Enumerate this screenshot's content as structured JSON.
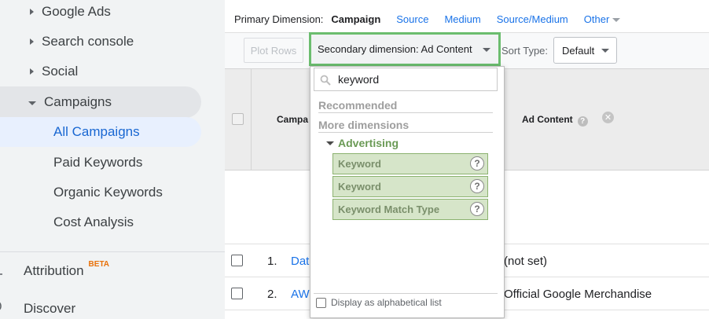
{
  "sidebar": {
    "items": [
      {
        "label": "Google Ads",
        "expanded": false
      },
      {
        "label": "Search console",
        "expanded": false
      },
      {
        "label": "Social",
        "expanded": false
      },
      {
        "label": "Campaigns",
        "expanded": true
      }
    ],
    "campaign_children": [
      {
        "label": "All Campaigns",
        "active": true
      },
      {
        "label": "Paid Keywords",
        "active": false
      },
      {
        "label": "Organic Keywords",
        "active": false
      },
      {
        "label": "Cost Analysis",
        "active": false
      }
    ],
    "attribution": {
      "label": "Attribution",
      "badge": "BETA"
    },
    "discover": {
      "label": "Discover"
    }
  },
  "primary_dimension": {
    "label": "Primary Dimension:",
    "current": "Campaign",
    "options": [
      "Source",
      "Medium",
      "Source/Medium"
    ],
    "other": "Other"
  },
  "toolbar": {
    "plot_rows": "Plot Rows",
    "secondary_dimension": "Secondary dimension: Ad Content",
    "sort_label": "Sort Type:",
    "sort_value": "Default"
  },
  "table": {
    "headers": {
      "campaign": "Campa",
      "ad_content": "Ad Content",
      "help": "?",
      "remove": "✕"
    },
    "rows": [
      {
        "num": "1.",
        "campaign": "Dat",
        "ad_content": "(not set)"
      },
      {
        "num": "2.",
        "campaign": "AW",
        "ad_content": "Official Google Merchandise"
      }
    ]
  },
  "dropdown": {
    "search_value": "keyword",
    "recommended": "Recommended",
    "more_dimensions": "More dimensions",
    "group": "Advertising",
    "options": [
      {
        "label": "Keyword",
        "help": "?"
      },
      {
        "label": "Keyword",
        "help": "?"
      },
      {
        "label": "Keyword Match Type",
        "help": "?"
      }
    ],
    "alphabetical": "Display as alphabetical list"
  },
  "colors": {
    "accent_blue": "#1a73e8",
    "highlight_green": "#6bbd6e",
    "option_bg": "#d6e5c9",
    "beta_orange": "#e8710a"
  }
}
